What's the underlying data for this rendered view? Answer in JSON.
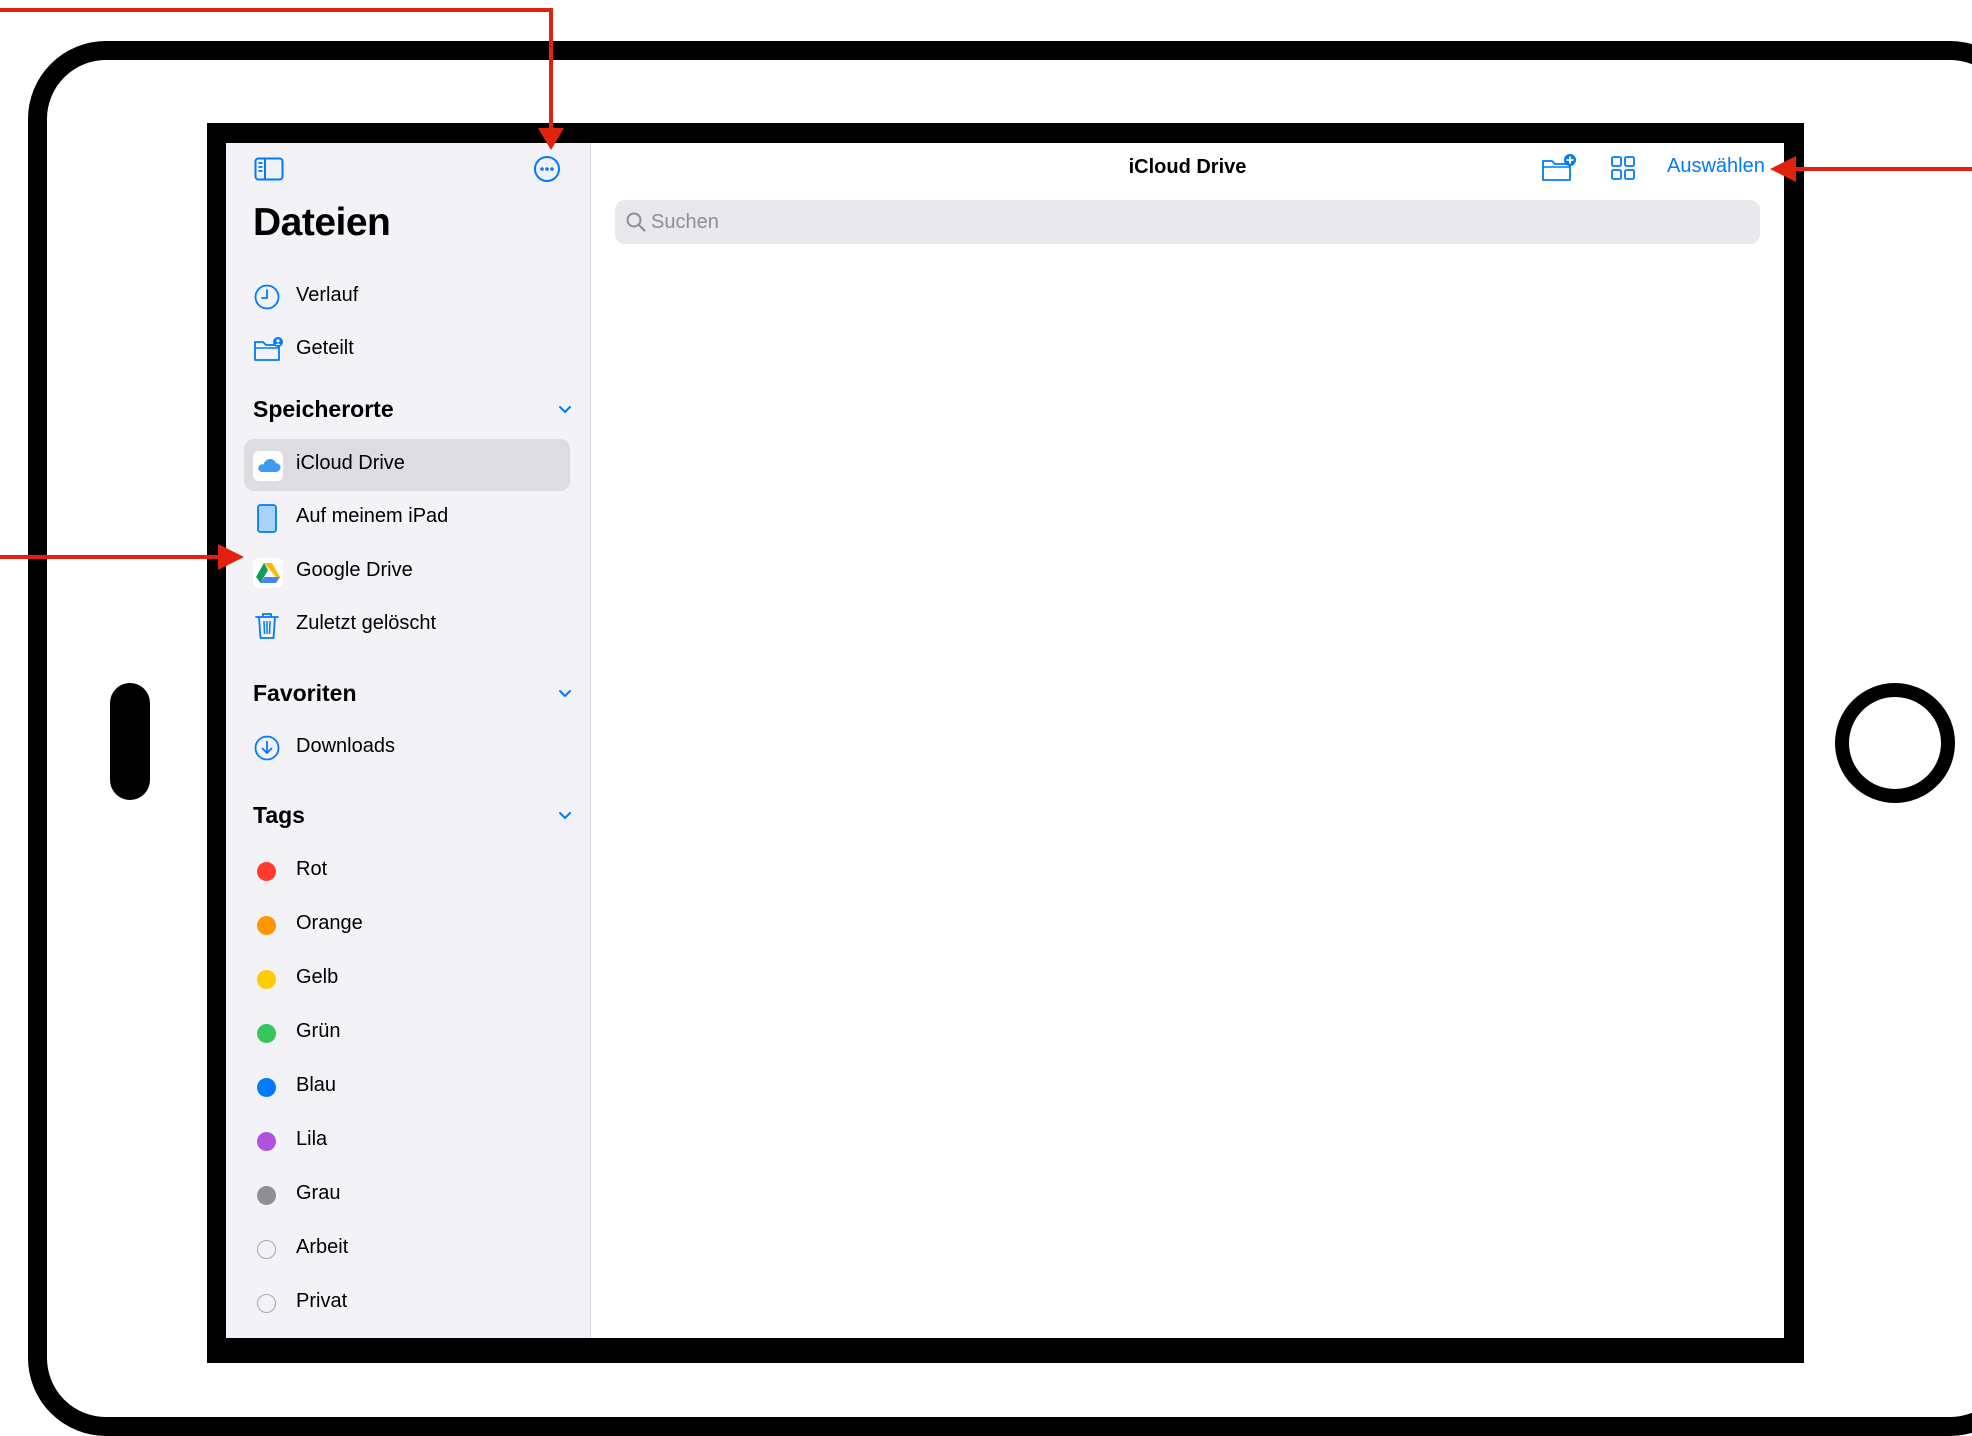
{
  "app": {
    "title": "Dateien"
  },
  "sidebar": {
    "quick_items": [
      {
        "label": "Verlauf",
        "icon": "clock-icon"
      },
      {
        "label": "Geteilt",
        "icon": "shared-folder-icon"
      }
    ],
    "sections": {
      "locations": {
        "title": "Speicherorte",
        "items": [
          {
            "label": "iCloud Drive",
            "icon": "icloud-icon",
            "selected": true
          },
          {
            "label": "Auf meinem iPad",
            "icon": "ipad-icon"
          },
          {
            "label": "Google Drive",
            "icon": "google-drive-icon"
          },
          {
            "label": "Zuletzt gelöscht",
            "icon": "trash-icon"
          }
        ]
      },
      "favorites": {
        "title": "Favoriten",
        "items": [
          {
            "label": "Downloads",
            "icon": "download-icon"
          }
        ]
      },
      "tags": {
        "title": "Tags",
        "items": [
          {
            "label": "Rot",
            "color": "#ff3b30"
          },
          {
            "label": "Orange",
            "color": "#ff9500"
          },
          {
            "label": "Gelb",
            "color": "#ffcc00"
          },
          {
            "label": "Grün",
            "color": "#34c759"
          },
          {
            "label": "Blau",
            "color": "#007aff"
          },
          {
            "label": "Lila",
            "color": "#af52de"
          },
          {
            "label": "Grau",
            "color": "#8e8e93"
          },
          {
            "label": "Arbeit",
            "color": "none"
          },
          {
            "label": "Privat",
            "color": "none"
          }
        ]
      }
    }
  },
  "content": {
    "title": "iCloud Drive",
    "select_label": "Auswählen",
    "search": {
      "placeholder": "Suchen",
      "value": ""
    }
  },
  "colors": {
    "accent": "#007aff",
    "annotation": "#e0220e",
    "sidebar_bg": "#f2f2f7",
    "selected_bg": "#dcdce1"
  }
}
